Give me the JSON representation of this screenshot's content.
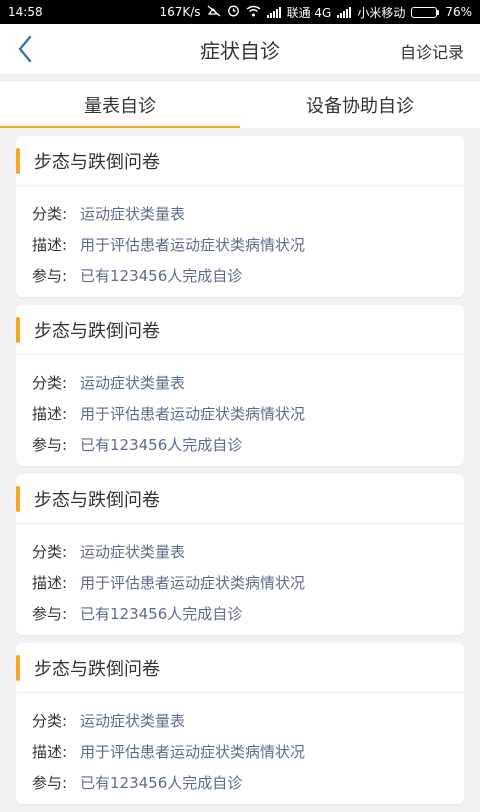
{
  "status_bar": {
    "time": "14:58",
    "speed": "167K/s",
    "carrier1": "联通 4G",
    "carrier2": "小米移动",
    "battery": "76%",
    "battery_level": 0.76
  },
  "nav": {
    "title": "症状自诊",
    "right_link": "自诊记录"
  },
  "tabs": [
    {
      "label": "量表自诊",
      "active": true
    },
    {
      "label": "设备协助自诊",
      "active": false
    }
  ],
  "cards": [
    {
      "title": "步态与跌倒问卷",
      "category_label": "分类:",
      "category": "运动症状类量表",
      "desc_label": "描述:",
      "desc": "用于评估患者运动症状类病情状况",
      "part_label": "参与:",
      "participants": "已有123456人完成自诊"
    },
    {
      "title": "步态与跌倒问卷",
      "category_label": "分类:",
      "category": "运动症状类量表",
      "desc_label": "描述:",
      "desc": "用于评估患者运动症状类病情状况",
      "part_label": "参与:",
      "participants": "已有123456人完成自诊"
    },
    {
      "title": "步态与跌倒问卷",
      "category_label": "分类:",
      "category": "运动症状类量表",
      "desc_label": "描述:",
      "desc": "用于评估患者运动症状类病情状况",
      "part_label": "参与:",
      "participants": "已有123456人完成自诊"
    },
    {
      "title": "步态与跌倒问卷",
      "category_label": "分类:",
      "category": "运动症状类量表",
      "desc_label": "描述:",
      "desc": "用于评估患者运动症状类病情状况",
      "part_label": "参与:",
      "participants": "已有123456人完成自诊"
    }
  ],
  "colors": {
    "accent": "#f5a623",
    "value_text": "#5b6d8c",
    "back_arrow": "#3e6fb0"
  }
}
